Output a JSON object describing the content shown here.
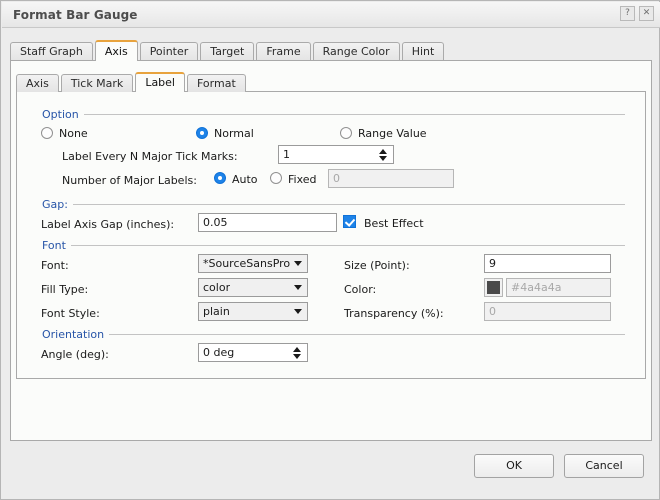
{
  "window": {
    "title": "Format Bar Gauge",
    "help_button": "?",
    "close_button": "✕"
  },
  "outer_tabs": [
    {
      "label": "Staff Graph",
      "active": false
    },
    {
      "label": "Axis",
      "active": true
    },
    {
      "label": "Pointer",
      "active": false
    },
    {
      "label": "Target",
      "active": false
    },
    {
      "label": "Frame",
      "active": false
    },
    {
      "label": "Range Color",
      "active": false
    },
    {
      "label": "Hint",
      "active": false
    }
  ],
  "inner_tabs": [
    {
      "label": "Axis",
      "active": false
    },
    {
      "label": "Tick Mark",
      "active": false
    },
    {
      "label": "Label",
      "active": true
    },
    {
      "label": "Format",
      "active": false
    }
  ],
  "option_group": {
    "title": "Option",
    "radios": [
      {
        "label": "None",
        "selected": false
      },
      {
        "label": "Normal",
        "selected": true
      },
      {
        "label": "Range Value",
        "selected": false
      }
    ],
    "label_every_n": {
      "label": "Label Every N Major Tick Marks:",
      "value": "1"
    },
    "number_of_major_labels": {
      "label": "Number of Major Labels:",
      "auto_label": "Auto",
      "auto_selected": true,
      "fixed_label": "Fixed",
      "fixed_selected": false,
      "fixed_value": "0"
    }
  },
  "gap_group": {
    "title": "Gap:",
    "label_axis_gap": {
      "label": "Label Axis Gap (inches):",
      "value": "0.05"
    },
    "best_effect": {
      "label": "Best Effect",
      "checked": true
    }
  },
  "font_group": {
    "title": "Font",
    "font": {
      "label": "Font:",
      "value": "*SourceSansPro"
    },
    "fill_type": {
      "label": "Fill Type:",
      "value": "color"
    },
    "font_style": {
      "label": "Font Style:",
      "value": "plain"
    },
    "size": {
      "label": "Size (Point):",
      "value": "9"
    },
    "color": {
      "label": "Color:",
      "value": "#4a4a4a",
      "swatch": "#4a4a4a"
    },
    "transparency": {
      "label": "Transparency (%):",
      "value": "0"
    }
  },
  "orientation_group": {
    "title": "Orientation",
    "angle": {
      "label": "Angle (deg):",
      "value": "0 deg"
    }
  },
  "footer": {
    "ok_label": "OK",
    "cancel_label": "Cancel"
  },
  "theme": {
    "accent": "#e8a33d",
    "group_title_color": "#2855a8",
    "selection_blue": "#1e83e8"
  }
}
